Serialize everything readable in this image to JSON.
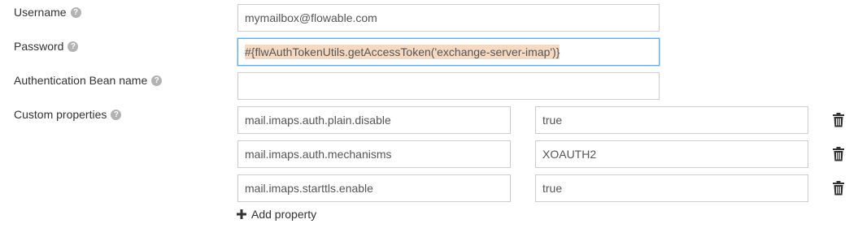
{
  "fields": {
    "username": {
      "label": "Username",
      "value": "mymailbox@flowable.com"
    },
    "password": {
      "label": "Password",
      "value": "#{flwAuthTokenUtils.getAccessToken('exchange-server-imap')}"
    },
    "auth_bean": {
      "label": "Authentication Bean name",
      "value": ""
    },
    "custom_properties": {
      "label": "Custom properties"
    }
  },
  "help_glyph": "?",
  "properties": [
    {
      "key": "mail.imaps.auth.plain.disable",
      "value": "true"
    },
    {
      "key": "mail.imaps.auth.mechanisms",
      "value": "XOAUTH2"
    },
    {
      "key": "mail.imaps.starttls.enable",
      "value": "true"
    }
  ],
  "add_property": {
    "icon": "plus-icon",
    "label": "Add property"
  },
  "icons": {
    "help": "question-circle-icon",
    "delete": "trash-icon"
  },
  "colors": {
    "focus_border": "#66afe9",
    "selection": "#f6d9c3",
    "input_border": "#cccccc"
  }
}
